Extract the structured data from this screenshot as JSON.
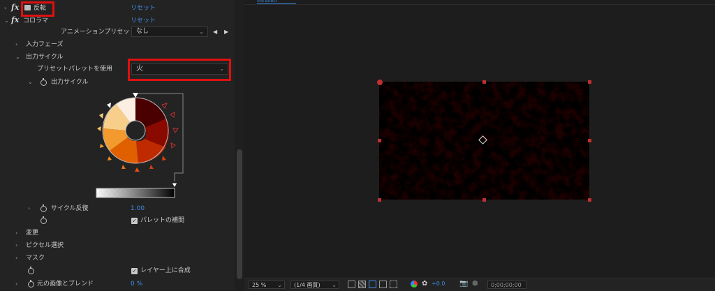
{
  "effects": {
    "invert": {
      "name": "反転",
      "reset": "リセット"
    },
    "colorama": {
      "name": "コロラマ",
      "reset": "リセット"
    }
  },
  "animation_preset": {
    "label": "アニメーションプリセット :",
    "value": "なし"
  },
  "input_phase": {
    "label": "入力フェーズ"
  },
  "output_cycle": {
    "label": "出力サイクル",
    "preset_palette_label": "プリセットパレットを使用",
    "preset_palette_value": "火",
    "inner_label": "出力サイクル",
    "cycle_repeat_label": "サイクル反復",
    "cycle_repeat_value": "1.00",
    "palette_interp_label": "パレットの補間",
    "palette_interp_checked": true
  },
  "sections": {
    "modify": "変更",
    "pixel_select": "ピクセル選択",
    "mask": "マスク"
  },
  "composite_on_layer": {
    "label": "レイヤー上に合成",
    "checked": true
  },
  "blend_original": {
    "label": "元の画像とブレンド",
    "value": "0 %"
  },
  "viewer": {
    "tab_label": "fire effect",
    "zoom": "25 %",
    "resolution": "(1/4 画質)",
    "exposure": "+0.0",
    "timecode": "0;00;00;00"
  },
  "colors": {
    "accent": "#3f8ee8",
    "highlight": "#e01010"
  }
}
